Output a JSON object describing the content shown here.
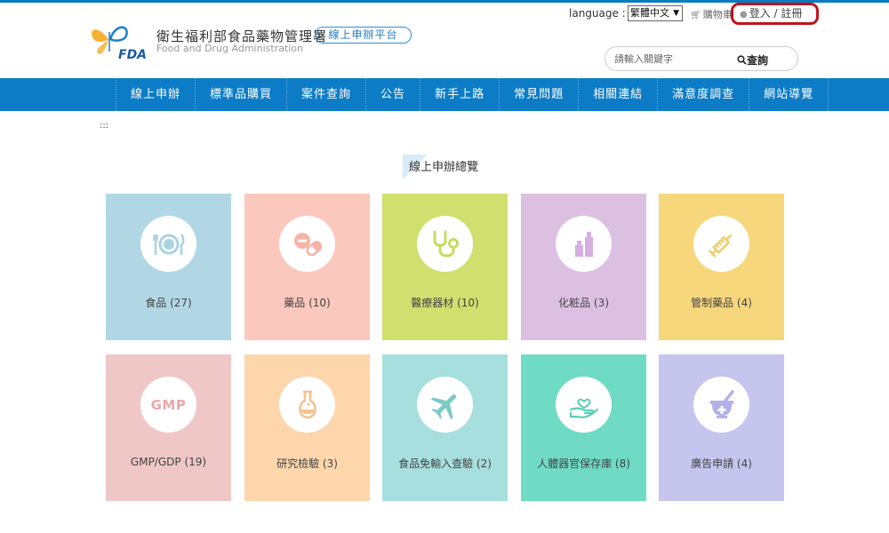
{
  "header": {
    "agency_zh": "衛生福利部食品藥物管理署",
    "agency_en": "Food and Drug Administration",
    "logo_text": "FDA",
    "platform_label": "線上申辦平台",
    "language_label": "language :",
    "language_selected": "繁體中文",
    "cart_label": "購物車",
    "login_label": "登入 / 註冊",
    "search_placeholder": "請輸入關鍵字",
    "search_button": "查詢"
  },
  "nav": {
    "items": [
      "線上申辦",
      "標準品購買",
      "案件查詢",
      "公告",
      "新手上路",
      "常見問題",
      "相關連結",
      "滿意度調查",
      "網站導覽"
    ]
  },
  "accesskey": ":::",
  "section_title": "線上申辦總覽",
  "categories": [
    {
      "label": "食品 (27)",
      "icon": "plate-utensils-icon",
      "color": "#b1d7e5",
      "icon_color": "#b1d7e5"
    },
    {
      "label": "藥品 (10)",
      "icon": "pills-icon",
      "color": "#fbc8bd",
      "icon_color": "#f7b3a5"
    },
    {
      "label": "醫療器材 (10)",
      "icon": "stethoscope-icon",
      "color": "#cfe06f",
      "icon_color": "#cfe06f"
    },
    {
      "label": "化粧品 (3)",
      "icon": "cosmetics-icon",
      "color": "#dcc0e2",
      "icon_color": "#d6aee0"
    },
    {
      "label": "管制藥品 (4)",
      "icon": "syringe-icon",
      "color": "#f6d77c",
      "icon_color": "#f1cd6b"
    },
    {
      "label": "GMP/GDP (19)",
      "icon": "gmp-icon",
      "color": "#efc7c7",
      "icon_color": "#e9a8aa"
    },
    {
      "label": "研究檢驗 (3)",
      "icon": "flask-icon",
      "color": "#fdd6ac",
      "icon_color": "#f6c08c"
    },
    {
      "label": "食品免輸入查驗 (2)",
      "icon": "airplane-icon",
      "color": "#a6dfdd",
      "icon_color": "#86cfcc"
    },
    {
      "label": "人體器官保存庫 (8)",
      "icon": "heart-hand-icon",
      "color": "#6fdbc4",
      "icon_color": "#5ccdb6"
    },
    {
      "label": "廣告申請 (4)",
      "icon": "mortar-icon",
      "color": "#c5c5ee",
      "icon_color": "#b4b0e8"
    }
  ]
}
